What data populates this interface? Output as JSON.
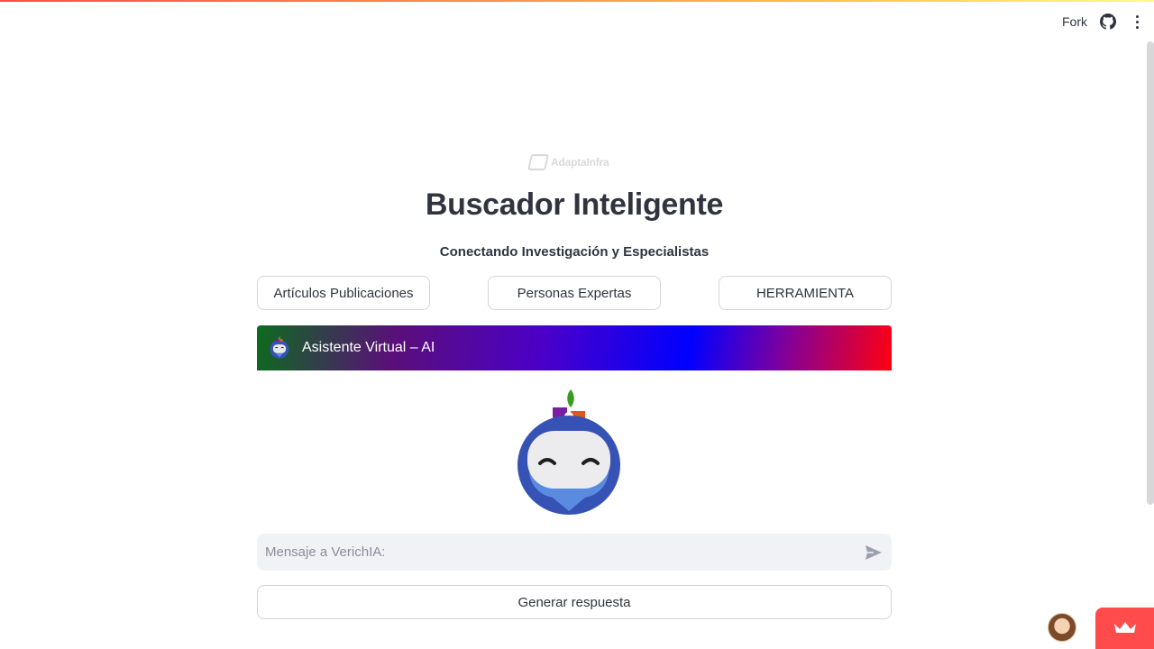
{
  "toolbar": {
    "fork_label": "Fork",
    "icons": [
      "github-icon",
      "more-vertical-icon"
    ]
  },
  "brand": {
    "logo_text": "AdaptaInfra"
  },
  "header": {
    "title": "Buscador Inteligente",
    "subtitle": "Conectando Investigación y Especialistas"
  },
  "nav_buttons": [
    {
      "label": "Artículos Publicaciones"
    },
    {
      "label": "Personas Expertas"
    },
    {
      "label": "HERRAMIENTA"
    }
  ],
  "assistant": {
    "label": "Asistente Virtual – AI",
    "avatar_icon": "robot-avatar-icon"
  },
  "chat": {
    "placeholder": "Mensaje a VerichIA:",
    "value": "",
    "send_icon": "send-icon"
  },
  "generate_button": {
    "label": "Generar respuesta"
  },
  "colors": {
    "accent": "#ff4b4b",
    "text": "#31333f",
    "input_bg": "#f0f2f6",
    "bot_blue": "#3652b4"
  }
}
